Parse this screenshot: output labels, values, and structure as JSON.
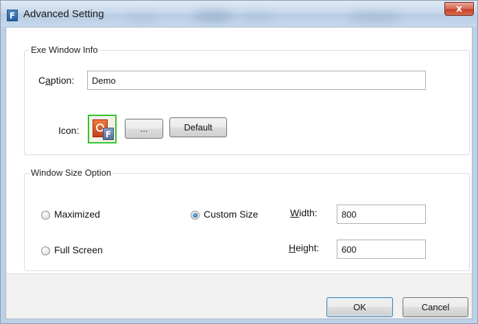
{
  "window": {
    "title": "Advanced Setting",
    "close_symbol": "x",
    "app_icon_letter": "F"
  },
  "exe_window_info": {
    "legend": "Exe Window Info",
    "caption": {
      "label_before": "C",
      "label_accel": "a",
      "label_after": "ption:",
      "value": "Demo"
    },
    "icon": {
      "label": "Icon:",
      "browse_label": "...",
      "default_label": "Default",
      "icon_letter": "F"
    }
  },
  "window_size_option": {
    "legend": "Window Size Option",
    "options": [
      {
        "label": "Maximized",
        "selected": false
      },
      {
        "label": "Full Screen",
        "selected": false
      },
      {
        "label": "Custom Size",
        "selected": true
      }
    ],
    "width": {
      "label_accel": "W",
      "label_rest": "idth:",
      "value": "800"
    },
    "height": {
      "label_accel": "H",
      "label_rest": "eight:",
      "value": "600"
    }
  },
  "footer": {
    "ok_label": "OK",
    "cancel_label": "Cancel"
  }
}
